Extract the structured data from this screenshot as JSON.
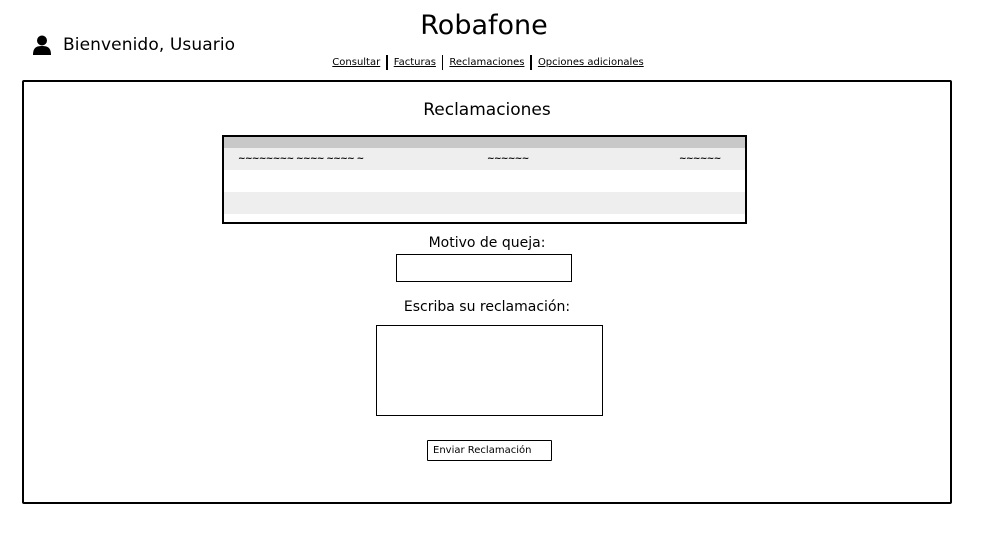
{
  "app": {
    "title": "Robafone",
    "welcome": "Bienvenido, Usuario",
    "user_icon": "user-icon"
  },
  "nav": {
    "items": [
      {
        "label": "Consultar"
      },
      {
        "label": "Facturas"
      },
      {
        "label": "Reclamaciones"
      },
      {
        "label": "Opciones adicionales"
      }
    ]
  },
  "main": {
    "title": "Reclamaciones",
    "table": {
      "row1": {
        "col1": "~~~~~~~~ ~~~~ ~~~~ ~",
        "col2": "~~~~~~",
        "col3": "~~~~~~"
      }
    },
    "motivo_label": "Motivo de queja:",
    "motivo_value": "",
    "reclamacion_label": "Escriba su reclamación:",
    "reclamacion_value": "",
    "submit_label": "Enviar Reclamación"
  }
}
